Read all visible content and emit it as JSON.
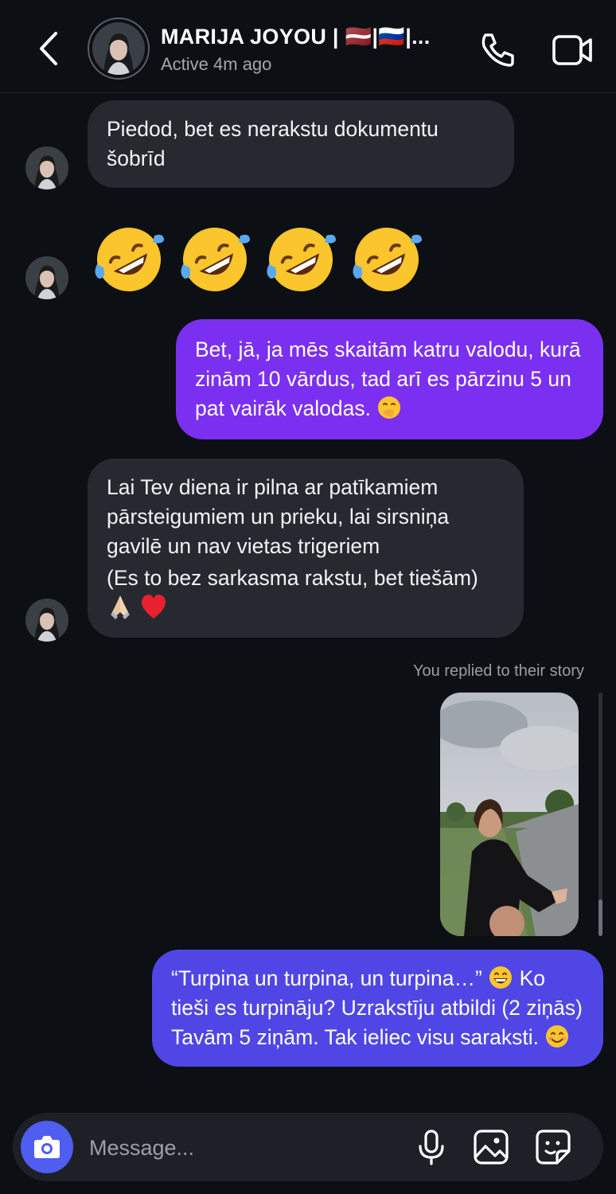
{
  "header": {
    "name": "MARIJA JOYOU | 🇱🇻|🇷🇺|...",
    "status": "Active 4m ago"
  },
  "messages": [
    {
      "from": "them",
      "text": "Piedod, bet es nerakstu dokumentu šobrīd"
    },
    {
      "from": "them",
      "emoji": [
        "rolling-on-floor-laughing-emoji",
        "rolling-on-floor-laughing-emoji",
        "rolling-on-floor-laughing-emoji",
        "rolling-on-floor-laughing-emoji"
      ]
    },
    {
      "from": "me",
      "text": "Bet, jā, ja mēs skaitām katru valodu, kurā zinām 10 vārdus, tad arī es pārzinu 5 un pat vairāk valodas.",
      "trailing_emoji": "face-with-hand-over-mouth"
    },
    {
      "from": "them",
      "text": "Lai Tev diena ir pilna ar patīkamiem pārsteigumiem un prieku, lai sirsniņa gavilē un nav vietas trigeriem",
      "text2": "(Es to bez sarkasma rakstu, bet tiešām)",
      "trailing_emoji": [
        "folded-hands",
        "red-heart"
      ]
    },
    {
      "from": "me",
      "story_label": "You replied to their story"
    },
    {
      "from": "me",
      "text": "“Turpina un turpina, un turpina…”",
      "text2": "Ko tieši es turpināju? Uzrakstīju atbildi (2 ziņās) Tavām 5 ziņām. Tak ieliec visu saraksti.",
      "emojis": [
        "grinning-face",
        "smiling-face"
      ]
    }
  ],
  "composer": {
    "placeholder": "Message..."
  },
  "colors": {
    "background": "#0c0f14",
    "incoming_bubble": "#26292f",
    "outgoing_purple": "#7b2ff0",
    "outgoing_blue": "#5046e6",
    "camera_button": "#4f5df0"
  },
  "icons": [
    "back-chevron-icon",
    "phone-icon",
    "video-camera-icon",
    "camera-icon",
    "microphone-icon",
    "gallery-icon",
    "sticker-icon"
  ]
}
